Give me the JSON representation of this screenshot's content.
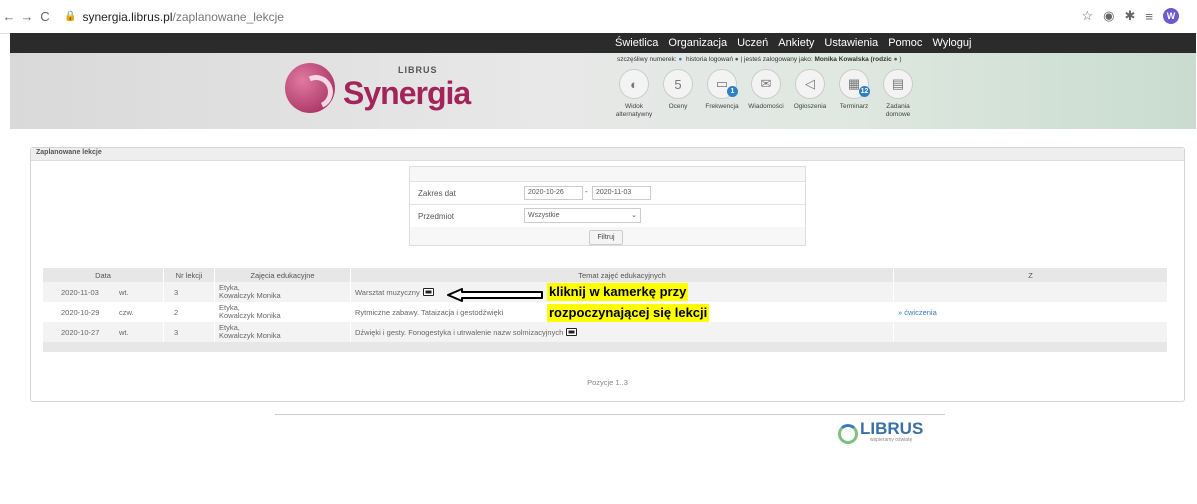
{
  "browser": {
    "url_host": "synergia.librus.pl",
    "url_path": "/zaplanowane_lekcje",
    "profile_initial": "W"
  },
  "topnav": [
    "Świetlica",
    "Organizacja",
    "Uczeń",
    "Ankiety",
    "Ustawienia",
    "Pomoc",
    "Wyloguj"
  ],
  "header": {
    "logo_text": "Synergia",
    "logo_librus": "LIBRUS",
    "userline": {
      "lucky": "szczęśliwy numerek:",
      "history": "historia logowań",
      "logged": "| jesteś zalogowany jako:",
      "user": "Monika Kowalska (rodzic",
      "close": ")"
    },
    "icons": [
      {
        "label": "Widok alternatywny",
        "icon": "half-circle-icon",
        "glyph": "◐",
        "badge": ""
      },
      {
        "label": "Oceny",
        "icon": "grades-icon",
        "glyph": "5",
        "badge": ""
      },
      {
        "label": "Frekwencja",
        "icon": "attendance-icon",
        "glyph": "▭",
        "badge": "1"
      },
      {
        "label": "Wiadomości",
        "icon": "envelope-icon",
        "glyph": "✉",
        "badge": ""
      },
      {
        "label": "Ogłoszenia",
        "icon": "megaphone-icon",
        "glyph": "◁",
        "badge": ""
      },
      {
        "label": "Terminarz",
        "icon": "calendar-icon",
        "glyph": "▦",
        "badge": "12"
      },
      {
        "label": "Zadania domowe",
        "icon": "homework-icon",
        "glyph": "▤",
        "badge": ""
      }
    ]
  },
  "panel": {
    "title": "Zaplanowane lekcje",
    "filter": {
      "date_label": "Zakres dat",
      "date_from": "2020-10-26",
      "date_sep": "-",
      "date_to": "2020-11-03",
      "subject_label": "Przedmiot",
      "subject_value": "Wszystkie",
      "button": "Filtruj"
    },
    "table": {
      "headers": [
        "Data",
        "Nr lekcji",
        "Zajęcia edukacyjne",
        "Temat zajęć edukacyjnych",
        "Z"
      ],
      "rows": [
        {
          "date": "2020-11-03",
          "day": "wt.",
          "nr": "3",
          "subject": "Etyka,",
          "teacher": "Kowalczyk Monika",
          "topic": "Warsztat muzyczny",
          "z": ""
        },
        {
          "date": "2020-10-29",
          "day": "czw.",
          "nr": "2",
          "subject": "Etyka,",
          "teacher": "Kowalczyk Monika",
          "topic": "Rytmiczne zabawy. Tataizacja i gestodźwięki",
          "z": "» ćwiczenia"
        },
        {
          "date": "2020-10-27",
          "day": "wt.",
          "nr": "3",
          "subject": "Etyka,",
          "teacher": "Kowalczyk Monika",
          "topic": "Dźwięki i gesty. Fonogestyka i utrwalenie nazw solmizacyjnych",
          "z": ""
        }
      ]
    },
    "pagination": "Pozycje 1..3"
  },
  "annotation": {
    "line1": "kliknij w kamerkę przy",
    "line2": "rozpoczynającej się lekcji"
  },
  "footer": {
    "logo": "LIBRUS",
    "tagline": "wspieramy oświatę"
  }
}
